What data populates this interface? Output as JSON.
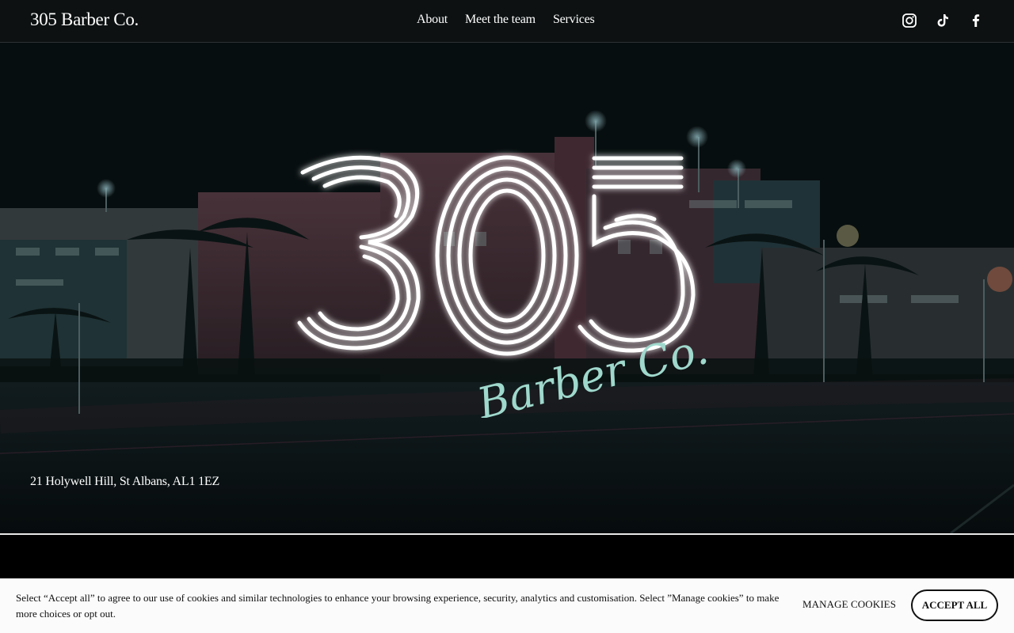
{
  "header": {
    "site_title": "305 Barber Co.",
    "nav": [
      "About",
      "Meet the team",
      "Services"
    ],
    "social_icons": [
      "instagram-icon",
      "tiktok-icon",
      "facebook-icon"
    ]
  },
  "hero": {
    "logo_number": "305",
    "logo_script": "Barber Co.",
    "address": "21 Holywell Hill, St Albans, AL1 1EZ"
  },
  "cookie_banner": {
    "text": "Select “Accept all” to agree to our use of cookies and similar technologies to enhance your browsing experience, security, analytics and customisation. Select ”Manage cookies” to make more choices or opt out.",
    "manage_label": "MANAGE COOKIES",
    "accept_label": "ACCEPT ALL"
  },
  "colors": {
    "header_bg": "#0d1112",
    "logo_stroke": "#ffffff",
    "logo_glow": "#7fe3dc",
    "script_color": "#9fd8cc",
    "banner_bg": "#fbfbfb"
  }
}
